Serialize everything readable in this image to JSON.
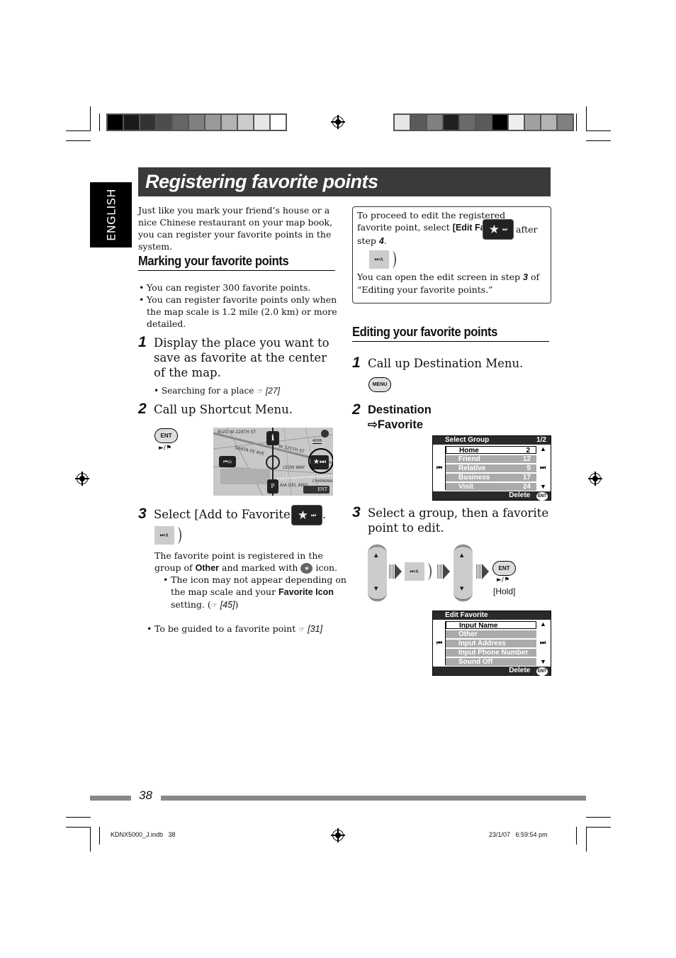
{
  "page": {
    "language_tab": "ENGLISH",
    "title": "Registering favorite points",
    "page_number": "38"
  },
  "colors": {
    "title_bar": "#3a3a3a",
    "left_swatches": [
      "#000000",
      "#1a1a1a",
      "#333333",
      "#4d4d4d",
      "#666666",
      "#808080",
      "#999999",
      "#b3b3b3",
      "#cccccc",
      "#e6e6e6",
      "#ffffff"
    ],
    "right_swatches": [
      "#e6e6e6",
      "#5a5a5a",
      "#808080",
      "#202020",
      "#6a6a6a",
      "#5a5a5a",
      "#000000",
      "#eeeeee",
      "#a0a0a0",
      "#b3b3b3",
      "#808080"
    ]
  },
  "intro": "Just like you mark your friend’s house or a nice Chinese restaurant on your map book, you can register your favorite points in the system.",
  "marking": {
    "heading": "Marking your favorite points",
    "bullets": [
      "You can register 300 favorite points.",
      "You can register favorite points only when the map scale is 1.2 mile (2.0 km) or more detailed."
    ],
    "step1": {
      "num": "1",
      "text": "Display the place you want to save as favorite at the center of the map.",
      "sub": "Searching for a place",
      "ref": "[27]"
    },
    "step2": {
      "num": "2",
      "text": "Call up Shortcut Menu.",
      "button": "ENT",
      "play_flag": "►/⚑"
    },
    "map": {
      "streets": [
        "BLVD",
        "W 228TH ST",
        "W 225TH ST",
        "SANTA FE AVE",
        "LEON WAY",
        "CHAPARRAL",
        "AIA DEL AMO",
        "ST"
      ],
      "scale": "400ft",
      "enter_label": "ENT"
    },
    "step3": {
      "num": "3",
      "text_prefix": "Select [Add to Favorite]",
      "para_prefix": "The favorite point is registered in the group of",
      "group": "Other",
      "para_mid": "and marked with",
      "para_suffix": "icon.",
      "note_prefix": "The icon may not appear depending on the map scale and your",
      "note_bold": "Favorite Icon",
      "note_suffix": "setting. (",
      "note_ref": "[45]",
      "note_close": ")"
    },
    "guide_bullet": {
      "text": "To be guided to a favorite point",
      "ref": "[31]"
    }
  },
  "note_box": {
    "line1": "To proceed to edit the registered favorite point, select",
    "bold": "[Edit Favorite]",
    "after": "after",
    "step_prefix": "step",
    "step_num": "4",
    "line2_prefix": "You can open the edit screen in step",
    "line2_num": "3",
    "line2_suffix": "of “Editing your favorite points.”"
  },
  "editing": {
    "heading": "Editing your favorite points",
    "step1": {
      "num": "1",
      "text": "Call up Destination Menu.",
      "button": "MENU"
    },
    "step2": {
      "num": "2",
      "line1": "Destination",
      "line2": "⇨Favorite"
    },
    "select_group_screen": {
      "title": "Select Group",
      "page": "1/2",
      "rows": [
        {
          "name": "Home",
          "count": "2",
          "selected": true
        },
        {
          "name": "Friend",
          "count": "12",
          "selected": false
        },
        {
          "name": "Relative",
          "count": "5",
          "selected": false
        },
        {
          "name": "Business",
          "count": "17",
          "selected": false
        },
        {
          "name": "Visit",
          "count": "24",
          "selected": false
        }
      ],
      "footer": "Delete",
      "footer_icon": "ENT"
    },
    "step3": {
      "num": "3",
      "text": "Select a group, then a favorite point to edit.",
      "button": "ENT",
      "play_flag": "►/⚑",
      "hold": "[Hold]"
    },
    "edit_favorite_screen": {
      "title": "Edit Favorite",
      "rows": [
        {
          "name": "Input Name",
          "selected": true
        },
        {
          "name": "Other",
          "selected": false
        },
        {
          "name": "Input Address",
          "selected": false
        },
        {
          "name": "Input Phone Number",
          "selected": false
        },
        {
          "name": "Sound Off",
          "selected": false
        }
      ],
      "footer": "Delete",
      "footer_icon": "ENT"
    }
  },
  "footer": {
    "file": "KDNX5000_J.indb   38",
    "timestamp": "23/1/07   6:59:54 pm"
  }
}
